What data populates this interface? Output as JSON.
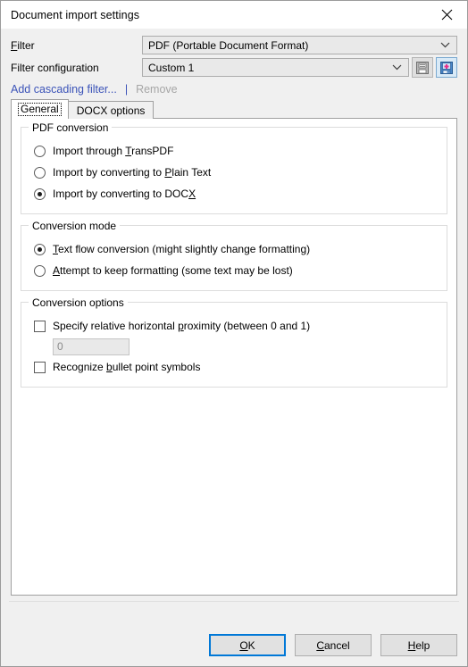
{
  "window": {
    "title": "Document import settings",
    "close_icon": "close-icon"
  },
  "form": {
    "filter": {
      "label_pre": "",
      "label_accel": "F",
      "label_post": "ilter",
      "value": "PDF (Portable Document Format)"
    },
    "filter_configuration": {
      "label": "Filter configuration",
      "value": "Custom 1",
      "save_button_icon": "save-floppy-icon",
      "save_as_button_icon": "save-as-new-floppy-icon"
    },
    "add_cascading_filter_link": "Add cascading filter...",
    "separator": "|",
    "remove_link": "Remove"
  },
  "tabs": [
    {
      "label": "General",
      "selected": true
    },
    {
      "label": "DOCX options",
      "selected": false
    }
  ],
  "groups": {
    "pdf_conversion": {
      "title": "PDF conversion",
      "options": [
        {
          "pre": "Import throu",
          "accel": "g",
          "post": "h ",
          "accel2": "T",
          "post2": "ransPDF",
          "checked": false
        },
        {
          "pre": "Import by converting to ",
          "accel": "P",
          "post": "lain Text",
          "checked": false
        },
        {
          "pre": "Import by converting to DOC",
          "accel": "X",
          "post": "",
          "checked": true
        }
      ]
    },
    "conversion_mode": {
      "title": "Conversion mode",
      "options": [
        {
          "pre": "",
          "accel": "T",
          "post": "ext flow conversion (might slightly change formatting)",
          "checked": true
        },
        {
          "pre": "",
          "accel": "A",
          "post": "ttempt to keep formatting (some text may be lost)",
          "checked": false
        }
      ]
    },
    "conversion_options": {
      "title": "Conversion options",
      "checkbox_proximity": {
        "pre": "Specify relative horizontal ",
        "accel": "p",
        "post": "roximity (between 0 and 1)",
        "checked": false
      },
      "proximity_value": "0",
      "checkbox_bullets": {
        "pre": "Recognize ",
        "accel": "b",
        "post": "ullet point symbols",
        "checked": false
      }
    }
  },
  "buttons": {
    "ok": {
      "pre": "",
      "accel": "O",
      "post": "K"
    },
    "cancel": {
      "pre": "",
      "accel": "C",
      "post": "ancel"
    },
    "help": {
      "pre": "",
      "accel": "H",
      "post": "elp"
    }
  },
  "colors": {
    "link": "#3b53b8",
    "default_button_border": "#0078d7",
    "dialog_bg": "#f0f0f0",
    "panel_bg": "#ffffff"
  }
}
